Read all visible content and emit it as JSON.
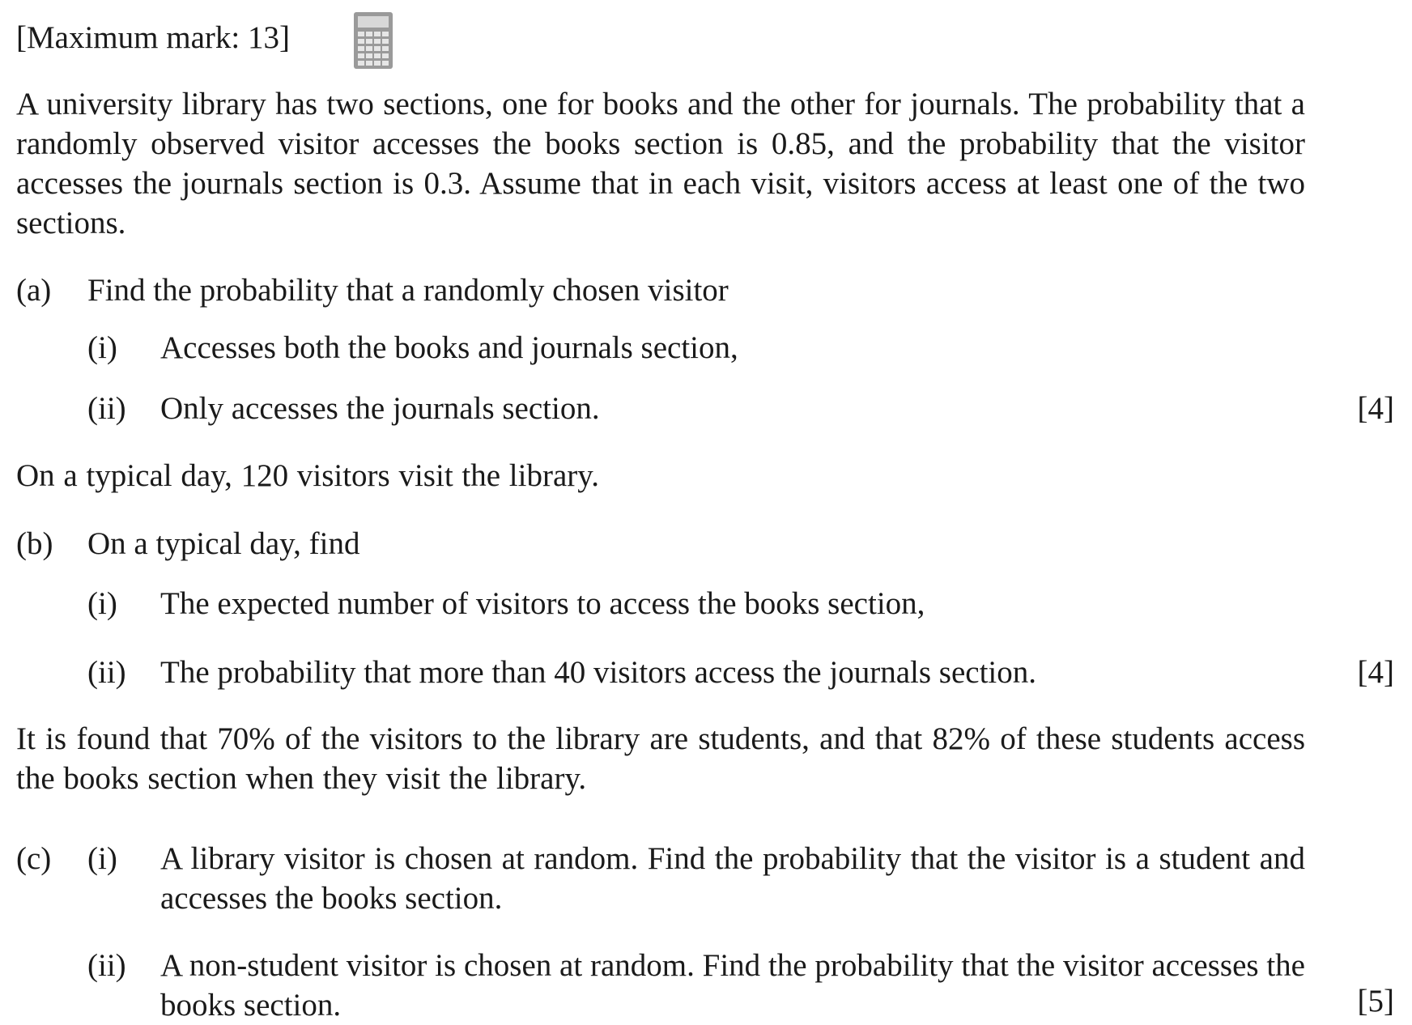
{
  "header": {
    "max_mark": "[Maximum mark: 13]",
    "calculator_icon": "calculator-icon"
  },
  "intro": "A university library has two sections, one for books and the other for journals. The probability that a randomly observed visitor accesses the books section is 0.85, and the probability that the visitor accesses the journals section is 0.3. Assume that in each visit, visitors access at least one of the two sections.",
  "part_a": {
    "label": "(a)",
    "stem": "Find the probability that a randomly chosen visitor",
    "i_label": "(i)",
    "i_text": "Accesses both the books and journals section,",
    "ii_label": "(ii)",
    "ii_text": "Only accesses the journals section.",
    "marks": "[4]"
  },
  "interlude_1": "On a typical day, 120 visitors visit the library.",
  "part_b": {
    "label": "(b)",
    "stem": "On a typical day, find",
    "i_label": "(i)",
    "i_text": "The expected number of visitors to access the books section,",
    "ii_label": "(ii)",
    "ii_text": "The probability that more than 40 visitors access the journals section.",
    "marks": "[4]"
  },
  "interlude_2": "It is found that 70% of the visitors to the library are students, and that 82% of these students access the books section when they visit the library.",
  "part_c": {
    "label": "(c)",
    "i_label": "(i)",
    "i_text": "A library visitor is chosen at random. Find the probability that the visitor is a student and accesses the books section.",
    "ii_label": "(ii)",
    "ii_text": "A non-student visitor is chosen at random. Find the probability that the visitor accesses the books section.",
    "marks": "[5]"
  }
}
